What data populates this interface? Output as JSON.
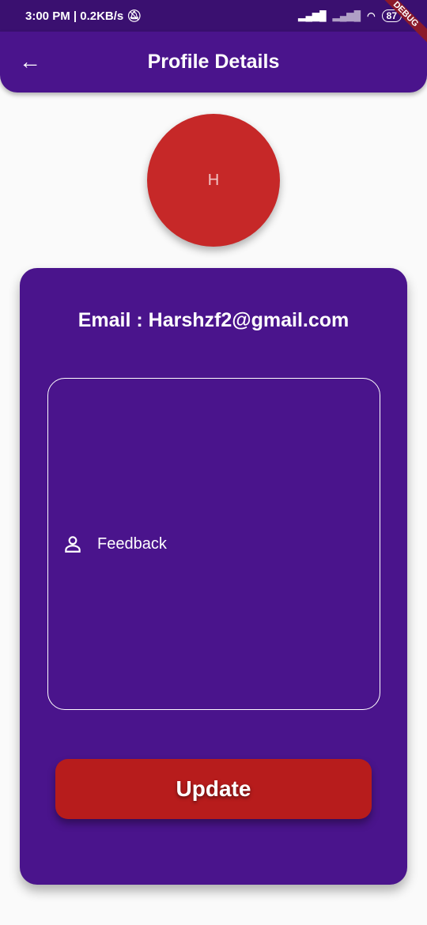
{
  "status": {
    "time": "3:00 PM | 0.2KB/s",
    "battery": "87"
  },
  "appbar": {
    "title": "Profile Details",
    "debug": "DEBUG"
  },
  "avatar": {
    "initial": "H"
  },
  "card": {
    "email": "Email : Harshzf2@gmail.com",
    "feedback_placeholder": "Feedback",
    "update_label": "Update"
  },
  "colors": {
    "primary": "#4a148c",
    "accent": "#b71c1c",
    "avatar": "#c62828"
  }
}
